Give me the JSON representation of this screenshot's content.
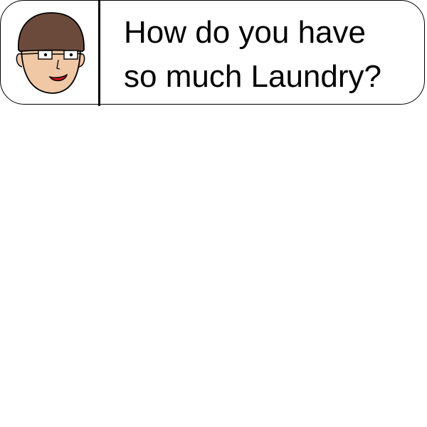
{
  "speech": {
    "line1": "How do you have",
    "line2": "so much Laundry?"
  },
  "avatar": {
    "icon": "man-with-glasses-face-icon",
    "skin_color": "#F0C8A6",
    "hair_color": "#6B4A3C",
    "lip_color": "#C8191E"
  }
}
